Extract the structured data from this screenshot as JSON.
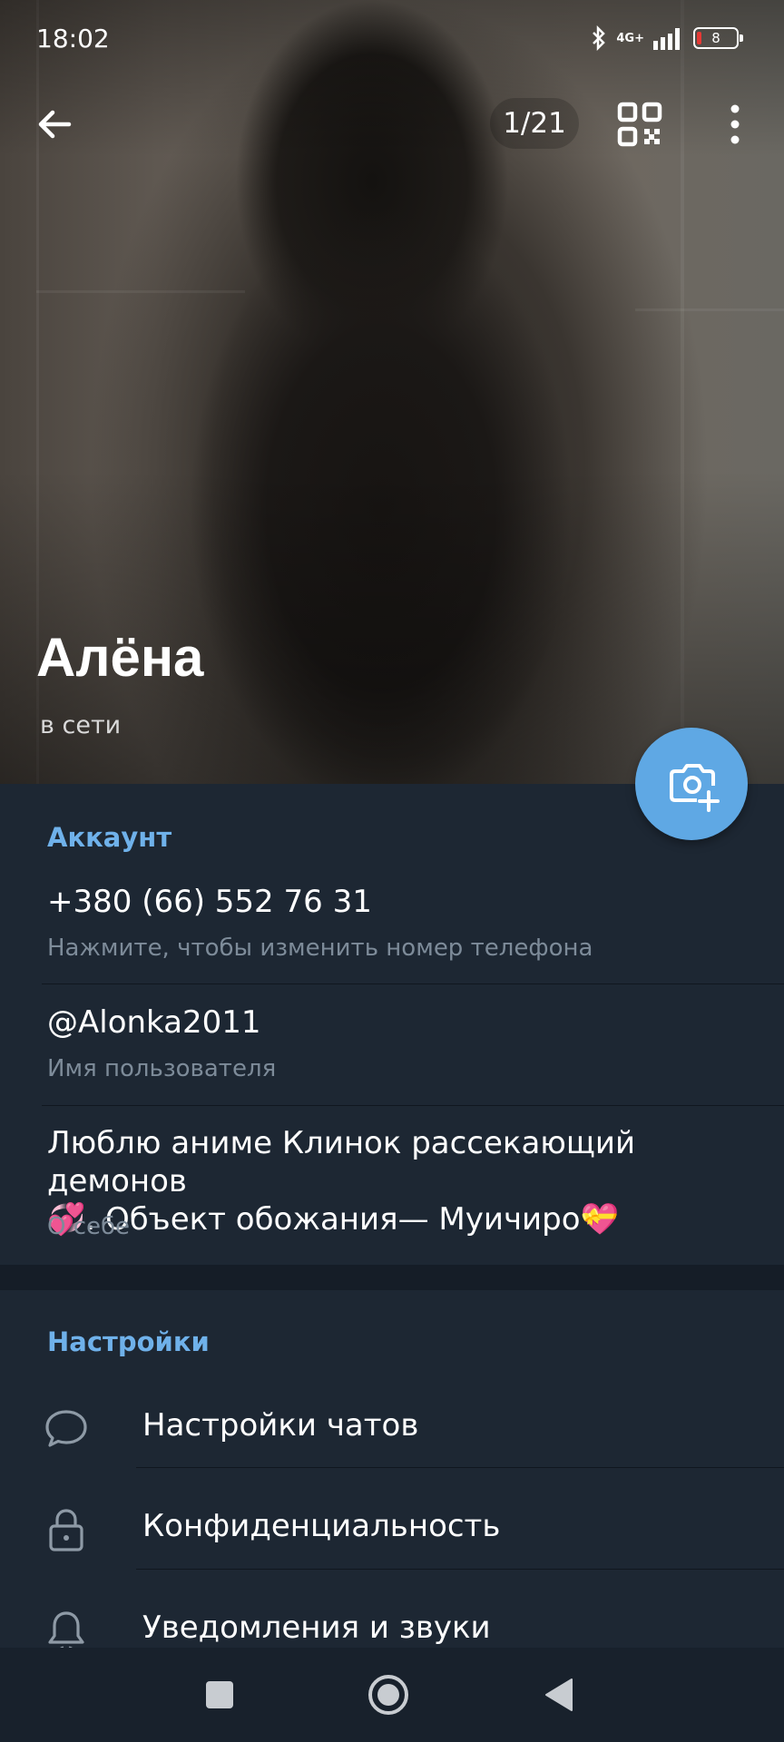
{
  "status_bar": {
    "time": "18:02",
    "network": "4G+",
    "battery_level": "8"
  },
  "toolbar": {
    "photo_counter": "1/21"
  },
  "profile": {
    "name": "Алёна",
    "status": "в сети"
  },
  "account": {
    "title": "Аккаунт",
    "phone": "+380 (66) 552 76 31",
    "phone_hint": "Нажмите, чтобы изменить номер телефона",
    "username": "@Alonka2011",
    "username_hint": "Имя пользователя",
    "bio_line1": "Люблю аниме Клинок рассекающий демонов",
    "bio_line2": "💞. Объект обожания— Муичиро💝",
    "bio_hint": "О себе"
  },
  "settings": {
    "title": "Настройки",
    "items": [
      {
        "label": "Настройки чатов",
        "icon": "chat-bubble-icon"
      },
      {
        "label": "Конфиденциальность",
        "icon": "lock-icon"
      },
      {
        "label": "Уведомления и звуки",
        "icon": "bell-icon"
      }
    ]
  },
  "colors": {
    "background": "#1d2733",
    "accent": "#6fb1ea",
    "fab": "#5fa8e4",
    "hint": "#7d8b99"
  }
}
